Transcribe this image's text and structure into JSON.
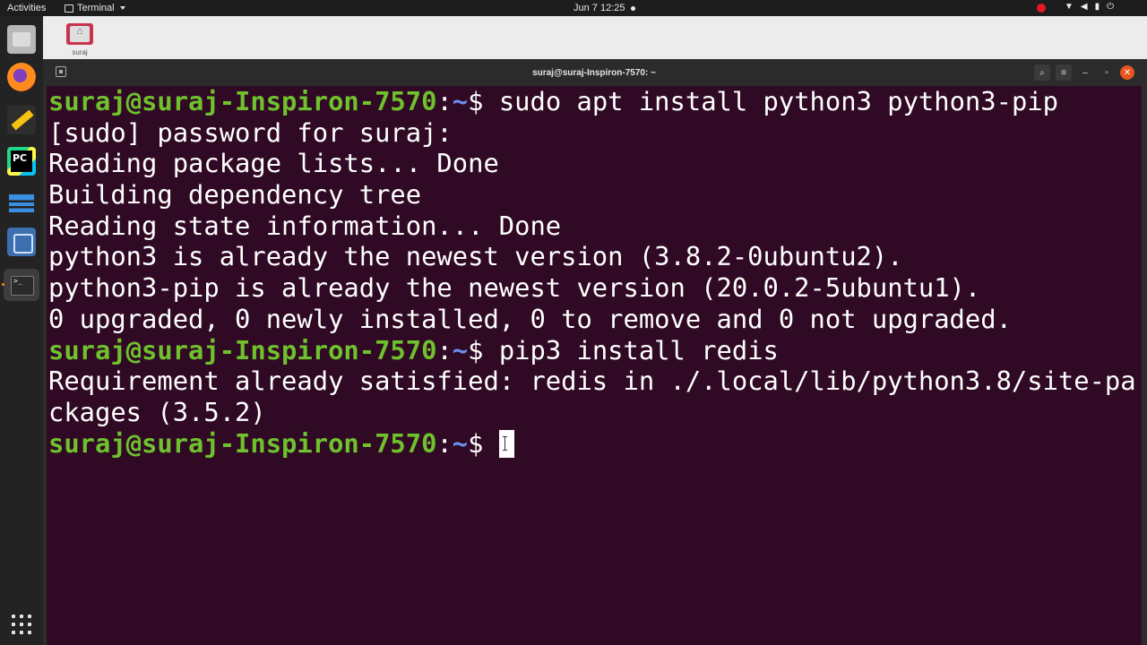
{
  "topbar": {
    "activities": "Activities",
    "app_name": "Terminal",
    "clock": "Jun 7  12:25"
  },
  "desktop": {
    "home_label": "suraj"
  },
  "window": {
    "title": "suraj@suraj-Inspiron-7570: ~"
  },
  "terminal": {
    "lines": [
      {
        "user": "suraj@suraj-Inspiron-7570",
        "sep": ":",
        "path": "~",
        "prompt": "$ ",
        "cmd": "sudo apt install python3 python3-pip"
      },
      {
        "text": "[sudo] password for suraj:"
      },
      {
        "text": "Reading package lists... Done"
      },
      {
        "text": "Building dependency tree"
      },
      {
        "text": "Reading state information... Done"
      },
      {
        "text": "python3 is already the newest version (3.8.2-0ubuntu2)."
      },
      {
        "text": "python3-pip is already the newest version (20.0.2-5ubuntu1)."
      },
      {
        "text": "0 upgraded, 0 newly installed, 0 to remove and 0 not upgraded."
      },
      {
        "user": "suraj@suraj-Inspiron-7570",
        "sep": ":",
        "path": "~",
        "prompt": "$ ",
        "cmd": "pip3 install redis"
      },
      {
        "text": "Requirement already satisfied: redis in ./.local/lib/python3.8/site-pa"
      },
      {
        "text": "ckages (3.5.2)"
      },
      {
        "user": "suraj@suraj-Inspiron-7570",
        "sep": ":",
        "path": "~",
        "prompt": "$ ",
        "cmd": ""
      }
    ]
  },
  "colors": {
    "terminal_bg": "#300a24",
    "user_green": "#6fc12d",
    "path_blue": "#6b8ff5",
    "close_orange": "#e95420",
    "record_red": "#e01b24"
  }
}
